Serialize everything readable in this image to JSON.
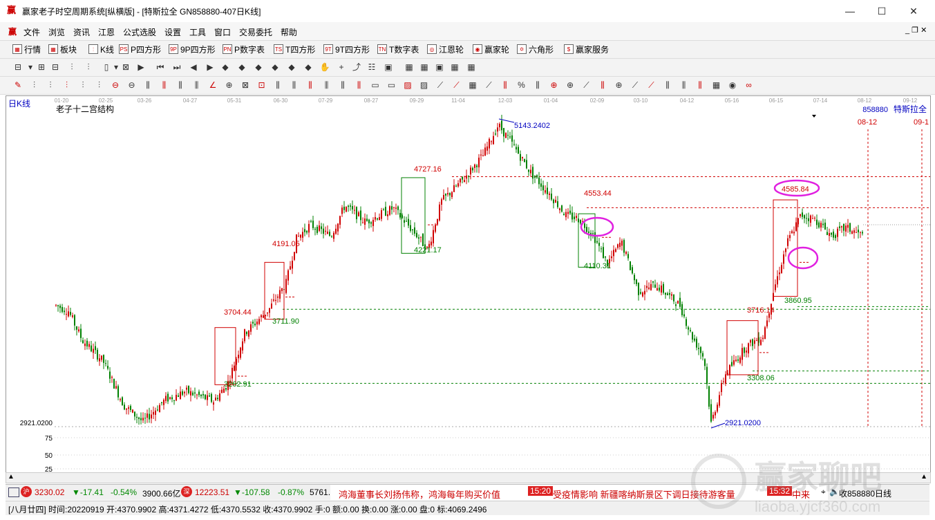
{
  "window": {
    "title": "赢家老子时空周期系统[纵横版] - [特斯拉全  GN858880-407日K线]",
    "logo": "赢",
    "min": "—",
    "max": "☐",
    "close": "✕"
  },
  "menu": [
    "文件",
    "浏览",
    "资讯",
    "江恩",
    "公式选股",
    "设置",
    "工具",
    "窗口",
    "交易委托",
    "帮助"
  ],
  "toolbar1": [
    {
      "icon": "grid-icon",
      "glyph": "▦",
      "label": "行情"
    },
    {
      "icon": "blocks-icon",
      "glyph": "▦",
      "label": "板块"
    },
    {
      "icon": "kline-icon",
      "glyph": "⫶",
      "label": "K线"
    },
    {
      "icon": "p-square-icon",
      "glyph": "PS",
      "label": "P四方形"
    },
    {
      "icon": "9p-square-icon",
      "glyph": "9P",
      "label": "9P四方形"
    },
    {
      "icon": "p-number-icon",
      "glyph": "PN",
      "label": "P数字表"
    },
    {
      "icon": "t-square-icon",
      "glyph": "TS",
      "label": "T四方形"
    },
    {
      "icon": "9t-square-icon",
      "glyph": "9T",
      "label": "9T四方形"
    },
    {
      "icon": "t-number-icon",
      "glyph": "TN",
      "label": "T数字表"
    },
    {
      "icon": "gann-wheel-icon",
      "glyph": "◎",
      "label": "江恩轮"
    },
    {
      "icon": "winner-wheel-icon",
      "glyph": "◉",
      "label": "赢家轮"
    },
    {
      "icon": "hexagon-icon",
      "glyph": "✡",
      "label": "六角形"
    },
    {
      "icon": "dollar-icon",
      "glyph": "$",
      "label": "赢家服务"
    }
  ],
  "chart": {
    "period_label": "日K线",
    "indicator_name": "老子十二宫结构",
    "code": "858880",
    "name": "特斯拉全",
    "date_labels": [
      "01-20",
      "02-25",
      "03-26",
      "04-27",
      "05-31",
      "06-30",
      "07-29",
      "08-27",
      "09-29",
      "11-04",
      "12-03",
      "01-04",
      "02-09",
      "03-10",
      "04-12",
      "05-16",
      "06-15",
      "07-14",
      "08-12",
      "09-12"
    ],
    "future_dates": [
      "08-12",
      "09-1"
    ],
    "y_left_labels": [
      "2921.0200",
      "75",
      "50",
      "25"
    ],
    "annotations": {
      "high": "5143.2402",
      "low": "2921.0200",
      "a1": "4727.16",
      "a2": "4553.44",
      "a3": "4585.84",
      "a4": "4191.05",
      "a5": "4221.17",
      "a6": "4110.31",
      "a7": "3704.44",
      "a8": "3711.90",
      "a9": "3860.95",
      "a10": "3716.14",
      "a11": "3262.91",
      "a12": "3308.06"
    },
    "colors": {
      "up": "#d00000",
      "down": "#008000",
      "blue": "#0000c0",
      "magenta": "#e020e0"
    }
  },
  "status1": {
    "sh_value": "3230.02",
    "sh_change": "▼-17.41",
    "sh_pct": "-0.54%",
    "sh_amount": "3900.66亿",
    "sz_value": "12223.51",
    "sz_change": "▼-107.58",
    "sz_pct": "-0.87%",
    "sz_amount": "5761.1",
    "news1": "鸿海董事长刘扬伟称，鸿海每年购买价值",
    "time2": "15:20",
    "news2": "受疫情影响 新疆喀纳斯景区下调日接待游客量",
    "time3": "15:32",
    "news3": "中来",
    "right": "收858880日线"
  },
  "status2": {
    "text": "[八月廿四] 时间:20220919 开:4370.9902 高:4371.4272 低:4370.5532 收:4370.9902 手:0 额:0.00 换:0.00 涨:0.00 盘:0 标:4069.2496"
  },
  "watermark": {
    "brand": "赢家聊吧",
    "url": "liaoba.yjcf360.com"
  }
}
